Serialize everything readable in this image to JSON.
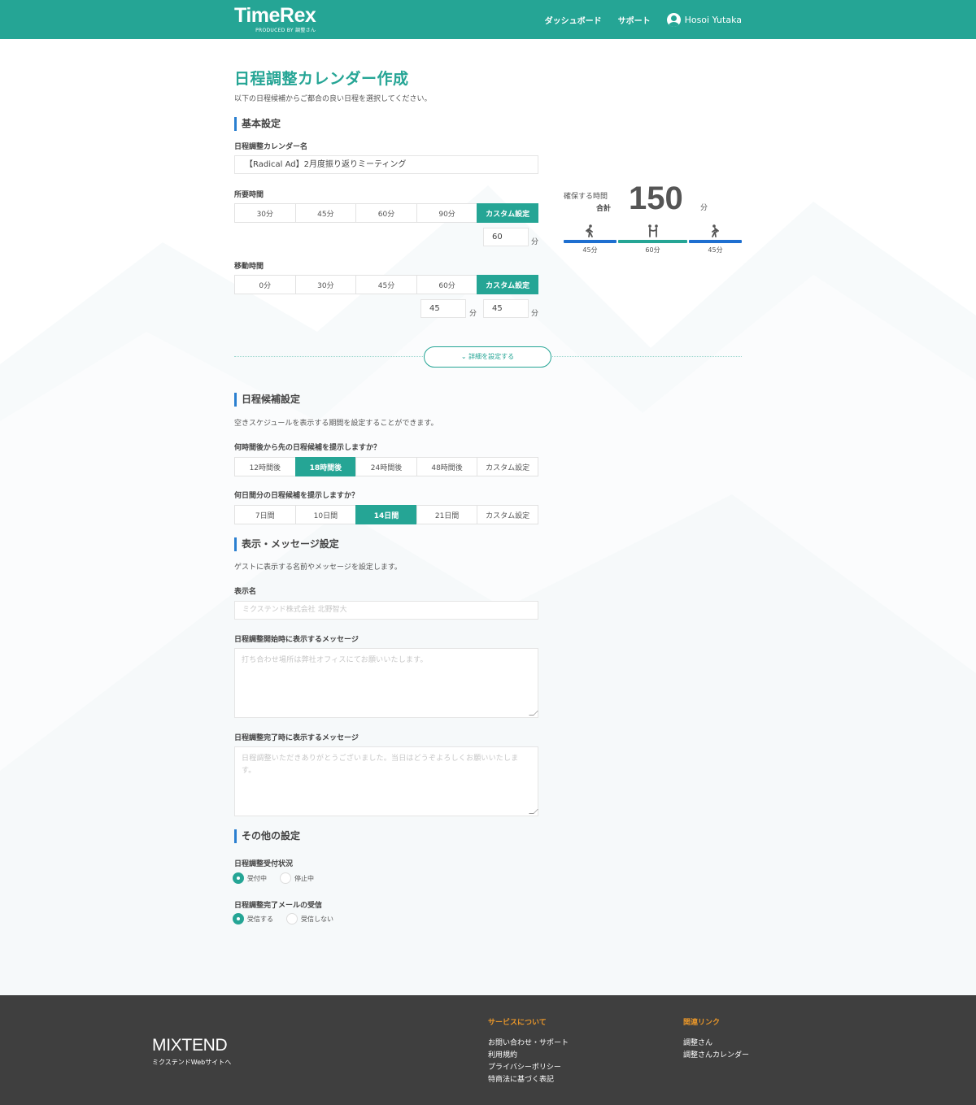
{
  "header": {
    "logo": "TimeRex",
    "logo_sub": "PRODUCED BY 調整さん",
    "nav": [
      "ダッシュボード",
      "サポート"
    ],
    "user": "Hosoi Yutaka"
  },
  "page": {
    "title": "日程調整カレンダー作成",
    "subtitle": "以下の日程候補からご都合の良い日程を選択してください。"
  },
  "basic": {
    "heading": "基本設定",
    "name_label": "日程調整カレンダー名",
    "name_value": "【Radical Ad】2月度振り返りミーティング",
    "duration_label": "所要時間",
    "duration_options": [
      "30分",
      "45分",
      "60分",
      "90分",
      "カスタム設定"
    ],
    "duration_selected": 4,
    "duration_custom": "60",
    "unit": "分",
    "travel_label": "移動時間",
    "travel_options": [
      "0分",
      "30分",
      "45分",
      "60分",
      "カスタム設定"
    ],
    "travel_selected": 4,
    "travel_before": "45",
    "travel_after": "45"
  },
  "summary": {
    "label1": "確保する時間",
    "label2": "合計",
    "total": "150",
    "unit": "分",
    "segments": [
      "45分",
      "60分",
      "45分"
    ]
  },
  "detail_button": "詳細を設定する",
  "candidate": {
    "heading": "日程候補設定",
    "desc": "空きスケジュールを表示する期間を設定することができます。",
    "q1": "何時間後から先の日程候補を提示しますか？",
    "q1_options": [
      "12時間後",
      "18時間後",
      "24時間後",
      "48時間後",
      "カスタム設定"
    ],
    "q1_selected": 1,
    "q2": "何日間分の日程候補を提示しますか？",
    "q2_options": [
      "7日間",
      "10日間",
      "14日間",
      "21日間",
      "カスタム設定"
    ],
    "q2_selected": 2
  },
  "display": {
    "heading": "表示・メッセージ設定",
    "desc": "ゲストに表示する名前やメッセージを設定します。",
    "name_label": "表示名",
    "name_placeholder": "ミクステンド株式会社 北野智大",
    "start_label": "日程調整開始時に表示するメッセージ",
    "start_placeholder": "打ち合わせ場所は弊社オフィスにてお願いいたします。",
    "end_label": "日程調整完了時に表示するメッセージ",
    "end_placeholder": "日程調整いただきありがとうございました。当日はどうぞよろしくお願いいたします。"
  },
  "other": {
    "heading": "その他の設定",
    "status_label": "日程調整受付状況",
    "status_options": [
      "受付中",
      "停止中"
    ],
    "status_selected": 0,
    "mail_label": "日程調整完了メールの受信",
    "mail_options": [
      "受信する",
      "受信しない"
    ],
    "mail_selected": 0
  },
  "footer": {
    "brand": "MIXTEND",
    "brand_sub": "ミクステンドWebサイトへ",
    "col1_head": "サービスについて",
    "col1_links": [
      "お問い合わせ・サポート",
      "利用規約",
      "プライバシーポリシー",
      "特商法に基づく表記"
    ],
    "col2_head": "関連リンク",
    "col2_links": [
      "調整さん",
      "調整さんカレンダー"
    ]
  },
  "colors": {
    "brand": "#25a595",
    "accent_blue": "#1e6fd0",
    "footer_bg": "#3f3f3f",
    "footer_head": "#e8962a"
  }
}
